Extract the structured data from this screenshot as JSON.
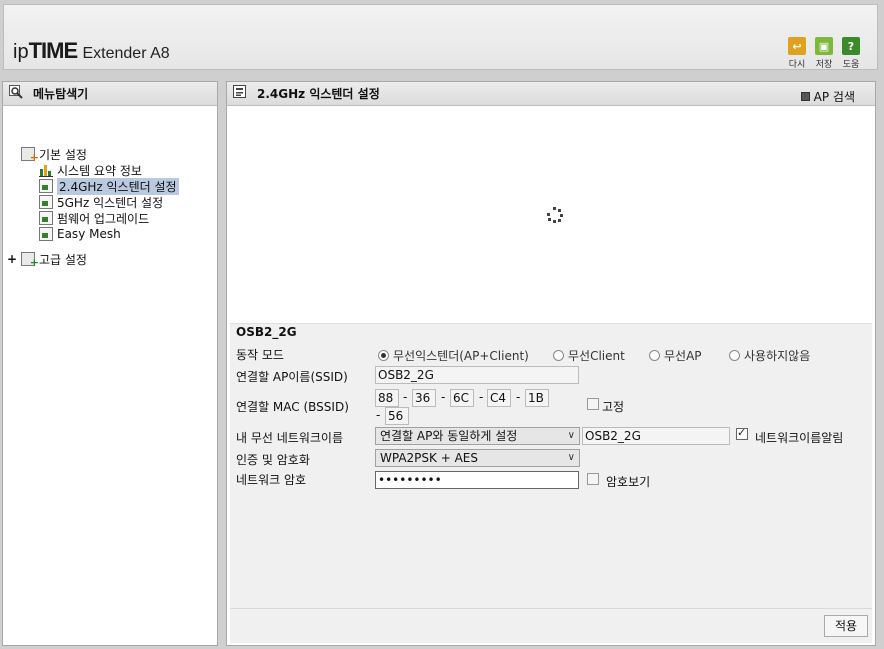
{
  "header": {
    "logo_ip": "ip",
    "logo_time": "TIME",
    "logo_product": "Extender A8",
    "buttons": [
      {
        "label": "다시",
        "icon": "undo-icon",
        "color": "#e0a020"
      },
      {
        "label": "저장",
        "icon": "save-icon",
        "color": "#7cb83a"
      },
      {
        "label": "도움",
        "icon": "help-icon",
        "color": "#3a8a2a"
      }
    ]
  },
  "left": {
    "title": "메뉴탐색기",
    "tree": {
      "basic": "기본 설정",
      "items": [
        "시스템 요약 정보",
        "2.4GHz 익스텐더 설정",
        "5GHz 익스텐더 설정",
        "펌웨어 업그레이드",
        "Easy Mesh"
      ],
      "advanced_toggle": "+",
      "advanced": "고급 설정"
    }
  },
  "right": {
    "title": "2.4GHz 익스텐더 설정",
    "ap_search": "AP 검색",
    "ssid_header": "OSB2_2G",
    "mode": {
      "label": "동작 모드",
      "options": [
        "무선익스텐더(AP+Client)",
        "무선Client",
        "무선AP",
        "사용하지않음"
      ],
      "selected": "무선익스텐더(AP+Client)"
    },
    "ssid": {
      "label": "연결할 AP이름(SSID)",
      "value": "OSB2_2G"
    },
    "mac": {
      "label": "연결할 MAC (BSSID)",
      "sep": "-",
      "octets": [
        "88",
        "36",
        "6C",
        "C4",
        "1B",
        "56"
      ],
      "fixed_label": "고정"
    },
    "my_network": {
      "label": "내 무선 네트워크이름",
      "select": "연결할 AP와 동일하게 설정",
      "value": "OSB2_2G",
      "broadcast_label": "네트워크이름알림"
    },
    "auth": {
      "label": "인증 및 암호화",
      "value": "WPA2PSK + AES"
    },
    "password": {
      "label": "네트워크 암호",
      "value": "•••••••••",
      "show_label": "암호보기"
    },
    "apply": "적용"
  }
}
